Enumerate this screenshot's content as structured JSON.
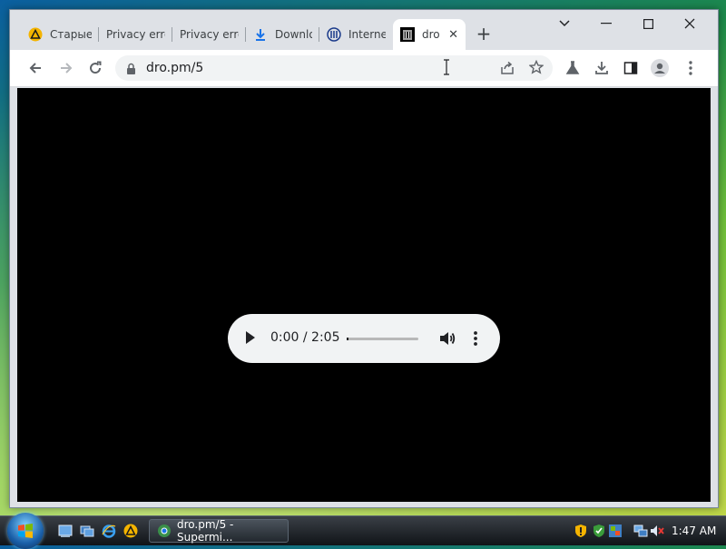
{
  "tabs": [
    {
      "label": "Старые",
      "icon": "warning-triangle-icon"
    },
    {
      "label": "Privacy error",
      "icon": ""
    },
    {
      "label": "Privacy error",
      "icon": ""
    },
    {
      "label": "Downlo",
      "icon": "download-arrow-icon"
    },
    {
      "label": "Internet",
      "icon": "archive-globe-icon"
    },
    {
      "label": "dro",
      "icon": "archive-building-icon"
    }
  ],
  "address_bar": {
    "url": "dro.pm/5"
  },
  "audio_player": {
    "time": "0:00 / 2:05",
    "progress": 0.0
  },
  "taskbar": {
    "task_label": "dro.pm/5 - Supermi...",
    "clock": "1:47 AM"
  },
  "colors": {
    "tab_strip": "#dee1e6",
    "content_bg": "#000000",
    "player_bg": "#f1f3f4"
  }
}
